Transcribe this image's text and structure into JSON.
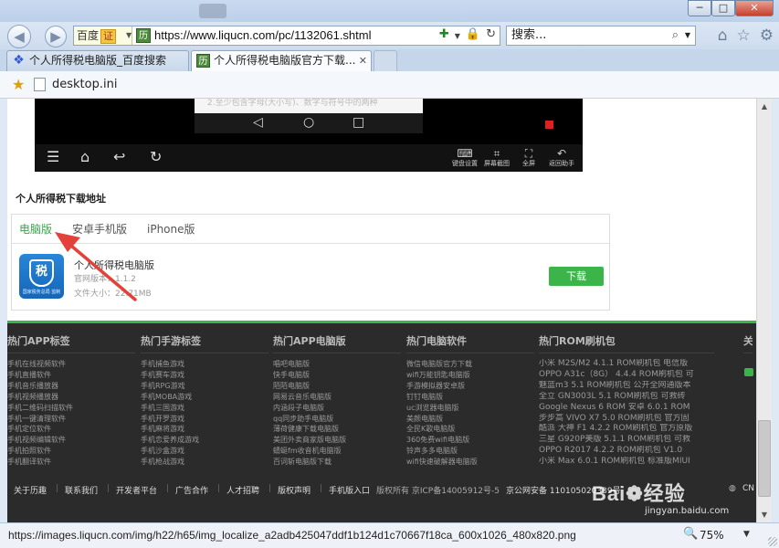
{
  "window": {
    "minimize": "─",
    "maximize": "□",
    "close": "✕"
  },
  "nav": {
    "back_icon": "arrow-left",
    "forward_icon": "arrow-right"
  },
  "address": {
    "engine": "百度",
    "cert": "证",
    "url": "https://www.liqucn.com/pc/1132061.shtml",
    "icons": [
      "green-plugin",
      "lock",
      "refresh"
    ]
  },
  "search": {
    "placeholder": "搜索..."
  },
  "tabs": [
    {
      "label": "个人所得税电脑版_百度搜索",
      "active": false
    },
    {
      "label": "个人所得税电脑版官方下载...",
      "active": true
    }
  ],
  "favorites": {
    "item": "desktop.ini"
  },
  "phone_screen": {
    "ghost_text": "2.至少包含字母(大小写)、数字与符号中的两种",
    "tools": [
      {
        "icon": "keyboard-icon",
        "label": "键盘设置"
      },
      {
        "icon": "crop-icon",
        "label": "屏幕截图"
      },
      {
        "icon": "fullscreen-icon",
        "label": "全屏"
      },
      {
        "icon": "return-icon",
        "label": "返回助手"
      }
    ]
  },
  "download": {
    "section_title": "个人所得税下载地址",
    "tabs": [
      "电脑版",
      "安卓手机版",
      "iPhone版"
    ],
    "app": {
      "icon_char": "税",
      "icon_sub": "国家税务总局 监制",
      "name": "个人所得税电脑版",
      "version": "官网版本：1.1.2",
      "size": "文件大小：22.71MB"
    },
    "button": "下载"
  },
  "footer": {
    "columns": [
      {
        "title": "热门APP标签",
        "items": [
          "手机在线视频软件",
          "手机直播软件",
          "手机音乐播放器",
          "手机视频播放器",
          "手机二维码扫描软件",
          "手机一键清理软件",
          "手机定位软件",
          "手机视频编辑软件",
          "手机拍照软件",
          "手机翻译软件"
        ]
      },
      {
        "title": "热门手游标签",
        "items": [
          "手机捕鱼游戏",
          "手机赛车游戏",
          "手机RPG游戏",
          "手机MOBA游戏",
          "手机三国游戏",
          "手机开罗游戏",
          "手机麻将游戏",
          "手机恋爱养成游戏",
          "手机沙盒游戏",
          "手机枪战游戏"
        ]
      },
      {
        "title": "热门APP电脑版",
        "items": [
          "唱吧电脑版",
          "快手电脑版",
          "陌陌电脑版",
          "网易云音乐电脑版",
          "内涵段子电脑版",
          "qq同步助手电脑版",
          "薄荷健康下载电脑版",
          "美团外卖商家版电脑版",
          "蜻蜓fm收音机电脑版",
          "百词斩电脑版下载"
        ]
      },
      {
        "title": "热门电脑软件",
        "items": [
          "微信电脑版官方下载",
          "wifi万能钥匙电脑版",
          "手游模拟器安卓版",
          "钉钉电脑版",
          "uc浏览器电脑版",
          "美颜电脑版",
          "全民K歌电脑版",
          "360免费wifi电脑版",
          "铃声多多电脑版",
          "wifi快速破解器电脑版"
        ]
      },
      {
        "title": "热门ROM刷机包",
        "items": [
          "小米 M2S/M2 4.1.1 ROM刷机包 电信版",
          "OPPO A31c（8G） 4.4.4 ROM刷机包 可",
          "魅蓝m3 5.1 ROM刷机包 公开全网通版本",
          "全立 GN3003L 5.1 ROM刷机包 可救砖",
          "Google Nexus 6 ROM 安卓 6.0.1 ROM",
          "步步高 VIVO X7 5.0 ROM刷机包 官方固",
          "酷派 大神 F1 4.2.2 ROM刷机包 官方原版",
          "三星 G920P美版 5.1.1 ROM刷机包 可救",
          "OPPO R2017 4.2.2 ROM刷机包 V1.0",
          "小米 Max 6.0.1 ROM刷机包 标准版MIUI"
        ]
      },
      {
        "title": "关注",
        "items": []
      }
    ],
    "bottom_links": [
      "关于历趣",
      "联系我们",
      "开发者平台",
      "广告合作",
      "人才招聘",
      "版权声明",
      "手机版入口"
    ],
    "copyright": "版权所有 京ICP备14005912号-5",
    "police": "京公网安备 110105020339号",
    "cn": "CN"
  },
  "watermark": {
    "main": "Bai❁经验",
    "sub": "jingyan.baidu.com"
  },
  "status": {
    "url": "https://images.liqucn.com/img/h22/h65/img_localize_a2adb425047ddf1b124d1c70667f18ca_600x1026_480x820.png",
    "zoom": "75%"
  },
  "colors": {
    "accent_green": "#3bb54a",
    "arrow_red": "#e3413a",
    "footer_bg": "#2b2b2b"
  }
}
